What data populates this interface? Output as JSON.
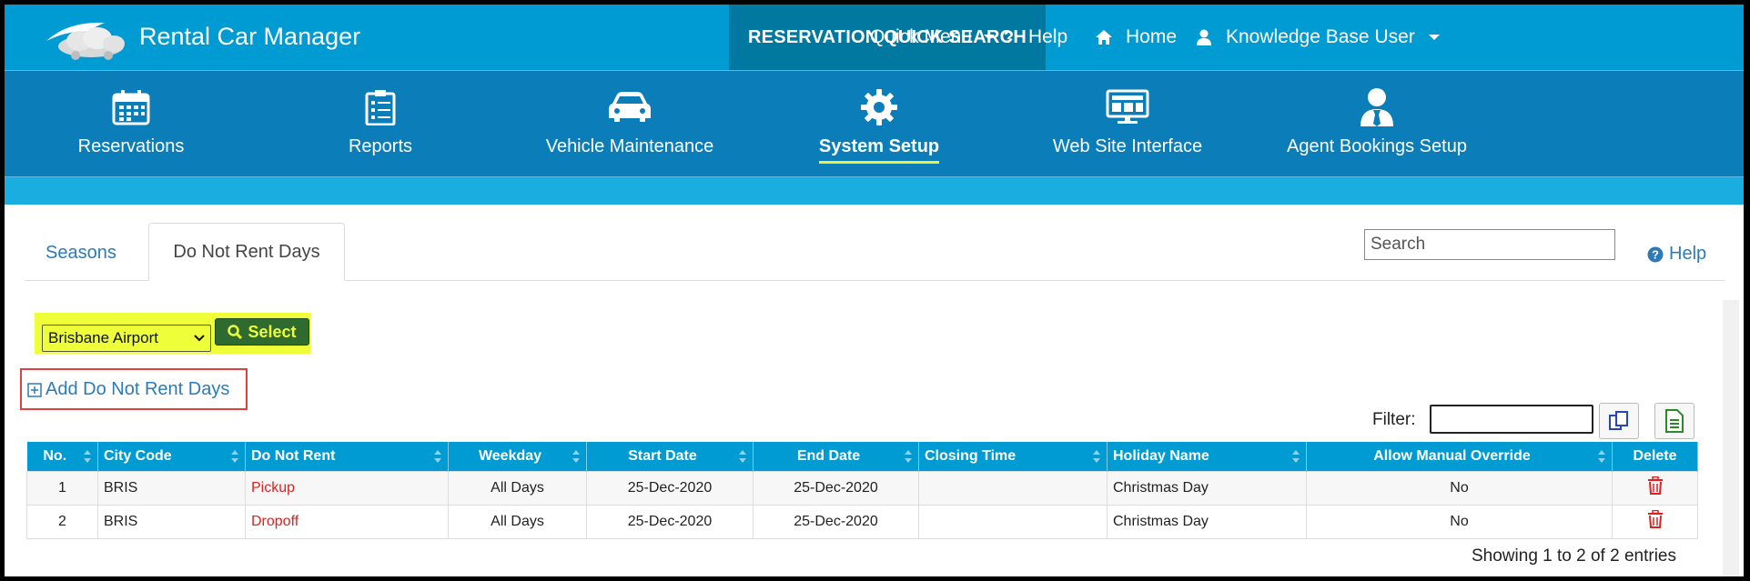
{
  "app": {
    "title": "Rental Car Manager"
  },
  "topbar": {
    "quick_search": "RESERVATION QUICK SEARCH",
    "quick_menu": "Quick Menu",
    "help": "Help",
    "home": "Home",
    "user": "Knowledge Base User"
  },
  "nav": {
    "items": [
      {
        "label": "Reservations",
        "icon": "calendar-icon"
      },
      {
        "label": "Reports",
        "icon": "clipboard-icon"
      },
      {
        "label": "Vehicle Maintenance",
        "icon": "car-icon"
      },
      {
        "label": "System Setup",
        "icon": "gear-icon",
        "active": true
      },
      {
        "label": "Web Site Interface",
        "icon": "monitor-icon"
      },
      {
        "label": "Agent Bookings Setup",
        "icon": "agent-icon"
      }
    ]
  },
  "tabs": [
    {
      "label": "Seasons",
      "active": false
    },
    {
      "label": "Do Not Rent Days",
      "active": true
    }
  ],
  "search": {
    "placeholder": "Search"
  },
  "help_link": "Help",
  "location": {
    "selected": "Brisbane Airport",
    "select_button": "Select"
  },
  "add_link": "Add Do Not Rent Days",
  "filter": {
    "label": "Filter:",
    "value": ""
  },
  "table": {
    "columns": [
      "No.",
      "City Code",
      "Do Not Rent",
      "Weekday",
      "Start Date",
      "End Date",
      "Closing Time",
      "Holiday Name",
      "Allow Manual Override",
      "Delete"
    ],
    "rows": [
      {
        "no": "1",
        "city": "BRIS",
        "do_not_rent": "Pickup",
        "weekday": "All Days",
        "start": "25-Dec-2020",
        "end": "25-Dec-2020",
        "closing": "",
        "holiday": "Christmas Day",
        "override": "No"
      },
      {
        "no": "2",
        "city": "BRIS",
        "do_not_rent": "Dropoff",
        "weekday": "All Days",
        "start": "25-Dec-2020",
        "end": "25-Dec-2020",
        "closing": "",
        "holiday": "Christmas Day",
        "override": "No"
      }
    ]
  },
  "info": "Showing 1 to 2 of 2 entries",
  "colors": {
    "topbar": "#009bd3",
    "nav": "#0b7eb9",
    "quick_search_bg": "#00789f",
    "highlight": "#eeff3a",
    "link": "#2c7bb7",
    "danger": "#e02020"
  }
}
